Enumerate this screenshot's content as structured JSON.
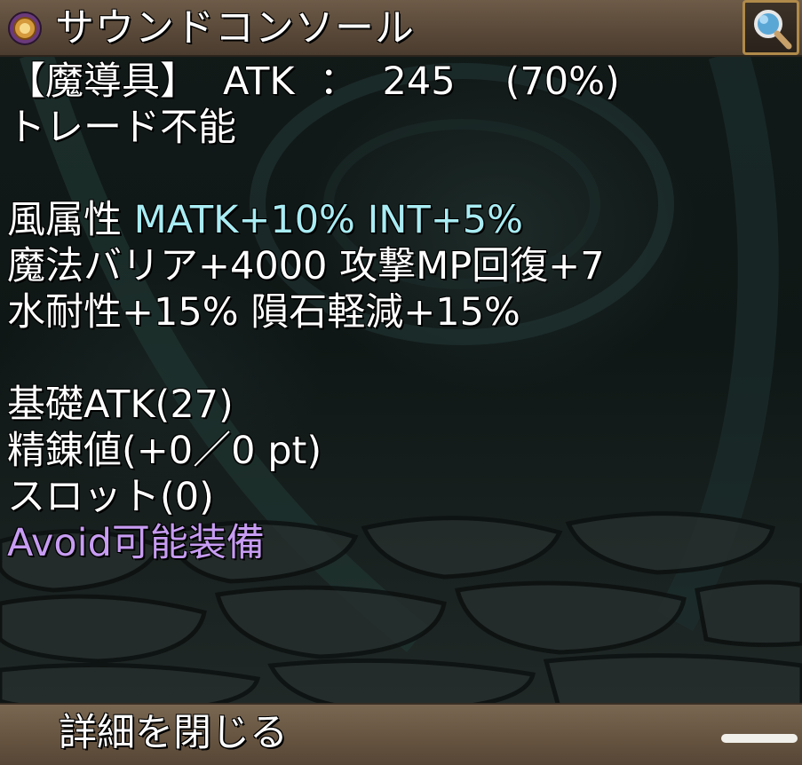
{
  "window": {
    "title": "サウンドコンソール",
    "title_icon": "orb-icon",
    "search_icon": "magnifier-icon"
  },
  "details": {
    "category": "【魔導具】",
    "atk_label": "ATK",
    "atk_separator": "：",
    "atk_value": "245",
    "atk_percent": "(70%)",
    "trade": "トレード不能",
    "element": "風属性",
    "element_bonus_1": "MATK+10%",
    "element_bonus_2": "INT+5%",
    "effect_1": "魔法バリア+4000",
    "effect_2": "攻撃MP回復+7",
    "effect_3": "水耐性+15%",
    "effect_4": "隕石軽減+15%",
    "base_atk": "基礎ATK(27)",
    "refine": "精錬値(+0／0 pt)",
    "slots": "スロット(0)",
    "avoid": "Avoid可能装備"
  },
  "footer": {
    "close_label": "詳細を閉じる"
  },
  "colors": {
    "text": "#ffffff",
    "cyan_stat": "#a9ecf3",
    "purple_note": "#c79cf2",
    "bar_brown": "#685642",
    "button_border": "#b08a4a"
  }
}
